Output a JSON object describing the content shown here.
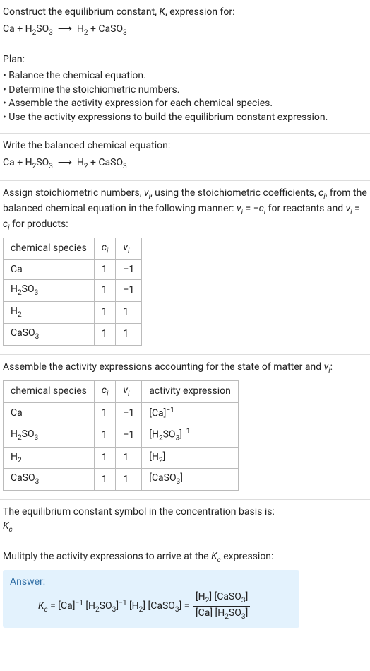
{
  "intro": {
    "line1_text": "Construct the equilibrium constant, ",
    "K": "K",
    "line1_tail": ", expression for:",
    "equation_html": "Ca + H<span class='sub'>2</span>SO<span class='sub'>3</span>&nbsp;&nbsp;⟶&nbsp;&nbsp;H<span class='sub'>2</span> + CaSO<span class='sub'>3</span>"
  },
  "plan": {
    "title": "Plan:",
    "items": [
      "• Balance the chemical equation.",
      "• Determine the stoichiometric numbers.",
      "• Assemble the activity expression for each chemical species.",
      "• Use the activity expressions to build the equilibrium constant expression."
    ]
  },
  "balanced": {
    "title": "Write the balanced chemical equation:",
    "equation_html": "Ca + H<span class='sub'>2</span>SO<span class='sub'>3</span>&nbsp;&nbsp;⟶&nbsp;&nbsp;H<span class='sub'>2</span> + CaSO<span class='sub'>3</span>"
  },
  "stoich": {
    "intro_html": "Assign stoichiometric numbers, <span class='mi'>ν<span class='sub'>i</span></span>, using the stoichiometric coefficients, <span class='mi'>c<span class='sub'>i</span></span>, from the balanced chemical equation in the following manner: <span class='mi'>ν<span class='sub'>i</span></span> = −<span class='mi'>c<span class='sub'>i</span></span> for reactants and <span class='mi'>ν<span class='sub'>i</span></span> = <span class='mi'>c<span class='sub'>i</span></span> for products:",
    "headers": {
      "species": "chemical species",
      "ci_html": "<span class='mi'>c<span class='sub'>i</span></span>",
      "vi_html": "<span class='mi'>ν<span class='sub'>i</span></span>"
    },
    "rows": [
      {
        "species_html": "Ca",
        "ci": "1",
        "vi": "−1"
      },
      {
        "species_html": "H<span class='sub'>2</span>SO<span class='sub'>3</span>",
        "ci": "1",
        "vi": "−1"
      },
      {
        "species_html": "H<span class='sub'>2</span>",
        "ci": "1",
        "vi": "1"
      },
      {
        "species_html": "CaSO<span class='sub'>3</span>",
        "ci": "1",
        "vi": "1"
      }
    ]
  },
  "activity": {
    "intro_html": "Assemble the activity expressions accounting for the state of matter and <span class='mi'>ν<span class='sub'>i</span></span>:",
    "headers": {
      "species": "chemical species",
      "ci_html": "<span class='mi'>c<span class='sub'>i</span></span>",
      "vi_html": "<span class='mi'>ν<span class='sub'>i</span></span>",
      "activity": "activity expression"
    },
    "rows": [
      {
        "species_html": "Ca",
        "ci": "1",
        "vi": "−1",
        "act_html": "[Ca]<span class='sup'>−1</span>"
      },
      {
        "species_html": "H<span class='sub'>2</span>SO<span class='sub'>3</span>",
        "ci": "1",
        "vi": "−1",
        "act_html": "[H<span class='sub'>2</span>SO<span class='sub'>3</span>]<span class='sup'>−1</span>"
      },
      {
        "species_html": "H<span class='sub'>2</span>",
        "ci": "1",
        "vi": "1",
        "act_html": "[H<span class='sub'>2</span>]"
      },
      {
        "species_html": "CaSO<span class='sub'>3</span>",
        "ci": "1",
        "vi": "1",
        "act_html": "[CaSO<span class='sub'>3</span>]"
      }
    ]
  },
  "basis": {
    "line": "The equilibrium constant symbol in the concentration basis is:",
    "symbol_html": "<span class='mi'>K<span class='sub'>c</span></span>"
  },
  "multiply": {
    "intro": "Mulitply the activity expressions to arrive at the ",
    "kc_html": "<span class='mi'>K<span class='sub'>c</span></span>",
    "tail": " expression:"
  },
  "answer": {
    "title": "Answer:",
    "lhs_html": "<span class='mi'>K<span class='sub'>c</span></span> = [Ca]<span class='sup'>−1</span> [H<span class='sub'>2</span>SO<span class='sub'>3</span>]<span class='sup'>−1</span> [H<span class='sub'>2</span>] [CaSO<span class='sub'>3</span>] = ",
    "frac_num_html": "[H<span class='sub'>2</span>] [CaSO<span class='sub'>3</span>]",
    "frac_den_html": "[Ca] [H<span class='sub'>2</span>SO<span class='sub'>3</span>]"
  },
  "chart_data": {
    "type": "table",
    "tables": [
      {
        "name": "stoichiometric-numbers",
        "columns": [
          "chemical species",
          "c_i",
          "ν_i"
        ],
        "rows": [
          [
            "Ca",
            1,
            -1
          ],
          [
            "H2SO3",
            1,
            -1
          ],
          [
            "H2",
            1,
            1
          ],
          [
            "CaSO3",
            1,
            1
          ]
        ]
      },
      {
        "name": "activity-expressions",
        "columns": [
          "chemical species",
          "c_i",
          "ν_i",
          "activity expression"
        ],
        "rows": [
          [
            "Ca",
            1,
            -1,
            "[Ca]^-1"
          ],
          [
            "H2SO3",
            1,
            -1,
            "[H2SO3]^-1"
          ],
          [
            "H2",
            1,
            1,
            "[H2]"
          ],
          [
            "CaSO3",
            1,
            1,
            "[CaSO3]"
          ]
        ]
      }
    ]
  }
}
